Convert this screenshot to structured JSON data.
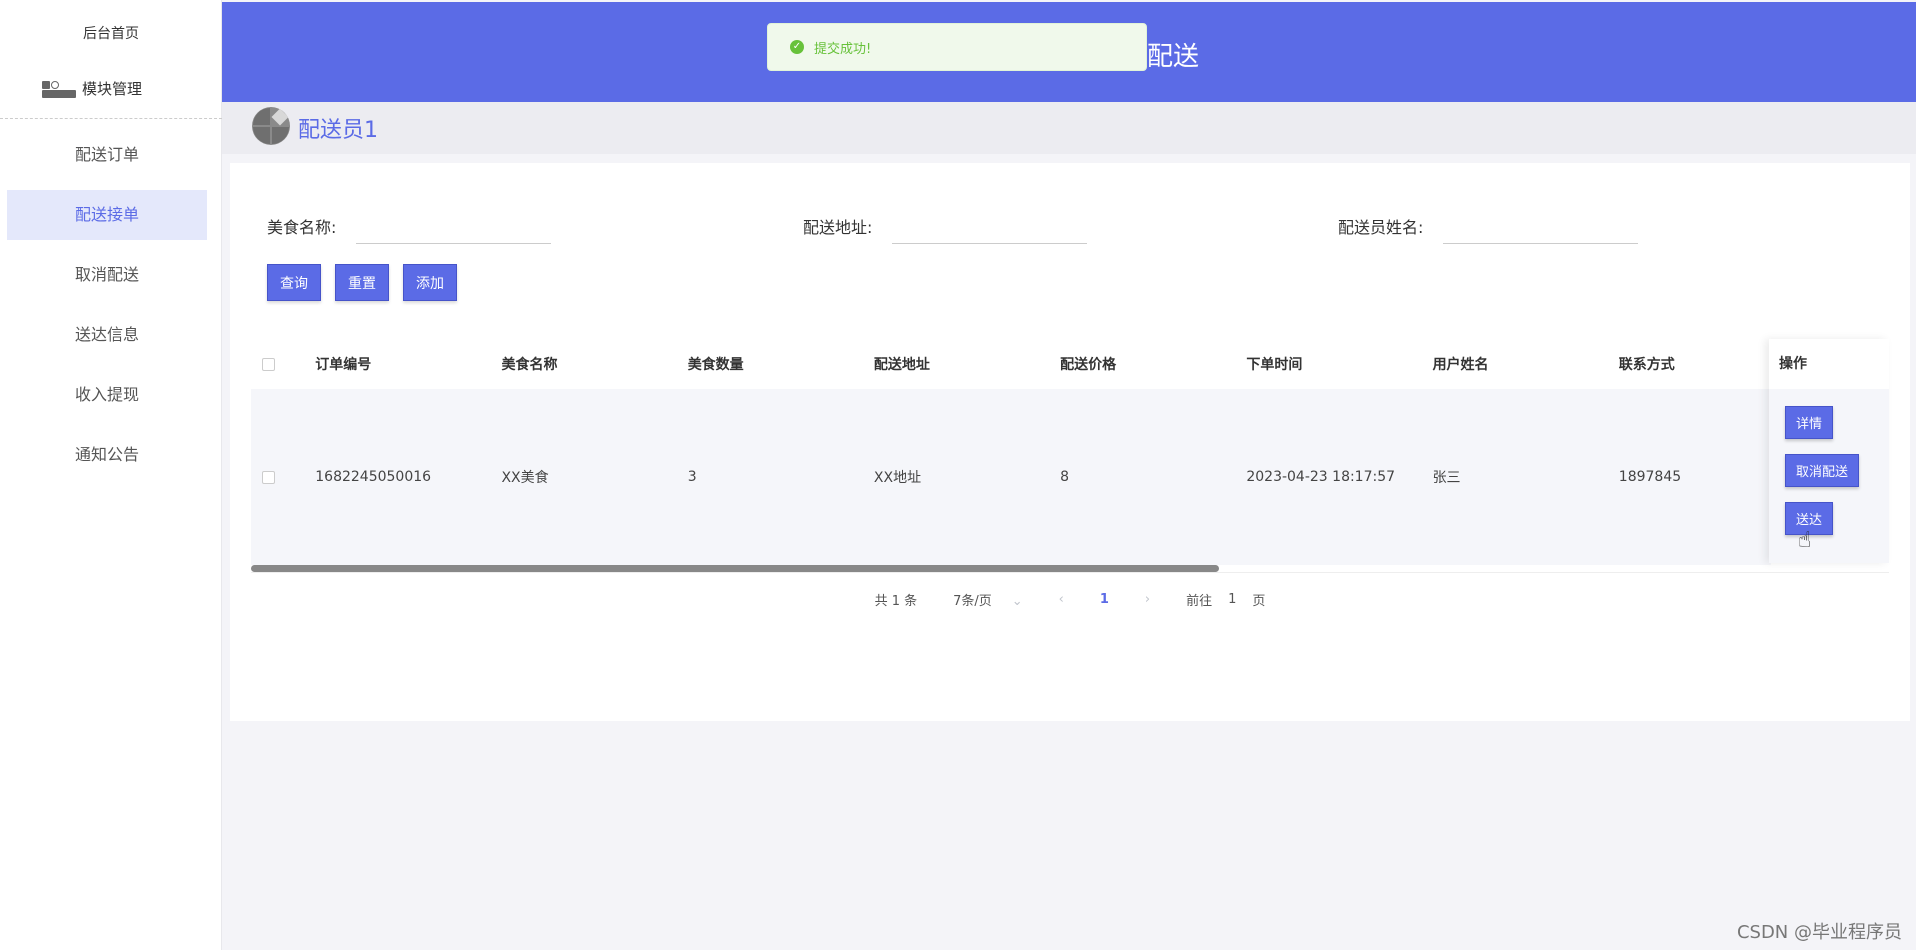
{
  "sidebar": {
    "home": "后台首页",
    "module": "模块管理",
    "items": [
      {
        "label": "配送订单",
        "active": false
      },
      {
        "label": "配送接单",
        "active": true
      },
      {
        "label": "取消配送",
        "active": false
      },
      {
        "label": "送达信息",
        "active": false
      },
      {
        "label": "收入提现",
        "active": false
      },
      {
        "label": "通知公告",
        "active": false
      }
    ]
  },
  "header": {
    "title": "配送"
  },
  "toast": {
    "message": "提交成功!",
    "icon": "success-check-icon"
  },
  "crumb": {
    "title": "配送员1"
  },
  "search": {
    "food_name_label": "美食名称:",
    "address_label": "配送地址:",
    "courier_label": "配送员姓名:",
    "food_name_value": "",
    "address_value": "",
    "courier_value": ""
  },
  "buttons": {
    "query": "查询",
    "reset": "重置",
    "add": "添加"
  },
  "table": {
    "columns": [
      "订单编号",
      "美食名称",
      "美食数量",
      "配送地址",
      "配送价格",
      "下单时间",
      "用户姓名",
      "联系方式"
    ],
    "op_column": "操作",
    "rows": [
      [
        "1682245050016",
        "XX美食",
        "3",
        "XX地址",
        "8",
        "2023-04-23 18:17:57",
        "张三",
        "1897845"
      ]
    ],
    "row_actions": [
      "详情",
      "取消配送",
      "送达"
    ]
  },
  "pagination": {
    "total": "共 1 条",
    "page_size": "7条/页",
    "current": "1",
    "goto_label": "前往",
    "goto_value": "1",
    "page_suffix": "页"
  },
  "watermark": "CSDN @毕业程序员",
  "colors": {
    "primary": "#5b6be6",
    "success": "#67c23a"
  }
}
